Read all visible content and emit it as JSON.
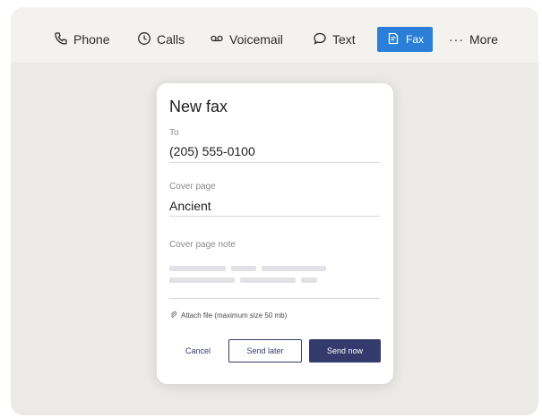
{
  "tabs": [
    {
      "label": "Phone",
      "icon": "phone-icon"
    },
    {
      "label": "Calls",
      "icon": "clock-icon"
    },
    {
      "label": "Voicemail",
      "icon": "voicemail-icon"
    },
    {
      "label": "Text",
      "icon": "chat-bubble-icon"
    },
    {
      "label": "Fax",
      "icon": "fax-icon",
      "active": true
    },
    {
      "label": "More",
      "icon": "ellipsis-icon"
    }
  ],
  "dialog": {
    "title": "New fax",
    "to_label": "To",
    "to_value": "(205) 555-0100",
    "cover_label": "Cover page",
    "cover_value": "Ancient",
    "note_label": "Cover page note",
    "attach_label": "Attach file (maximum size 50 mb)",
    "cancel_label": "Cancel",
    "send_later_label": "Send later",
    "send_now_label": "Send now"
  },
  "colors": {
    "accent_blue": "#2b7fd8",
    "primary_button": "#343a6b",
    "background": "#ebeae6"
  }
}
